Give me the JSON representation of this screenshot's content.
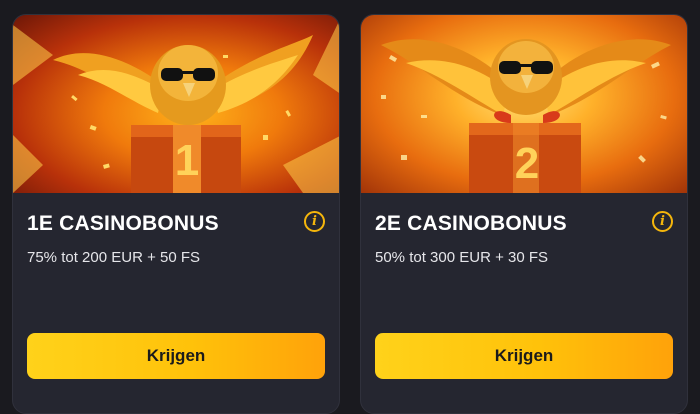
{
  "cards": [
    {
      "title": "1E CASINOBONUS",
      "subtitle": "75% tot 200 EUR + 50 FS",
      "button_label": "Krijgen",
      "info_icon": "info-icon",
      "box_number": "1"
    },
    {
      "title": "2E CASINOBONUS",
      "subtitle": "50% tot 300 EUR + 30 FS",
      "button_label": "Krijgen",
      "info_icon": "info-icon",
      "box_number": "2"
    }
  ],
  "colors": {
    "card_bg": "#252630",
    "page_bg": "#1a1a1f",
    "accent": "#f5b60c",
    "button_start": "#ffd21a",
    "button_end": "#ffa20a"
  }
}
